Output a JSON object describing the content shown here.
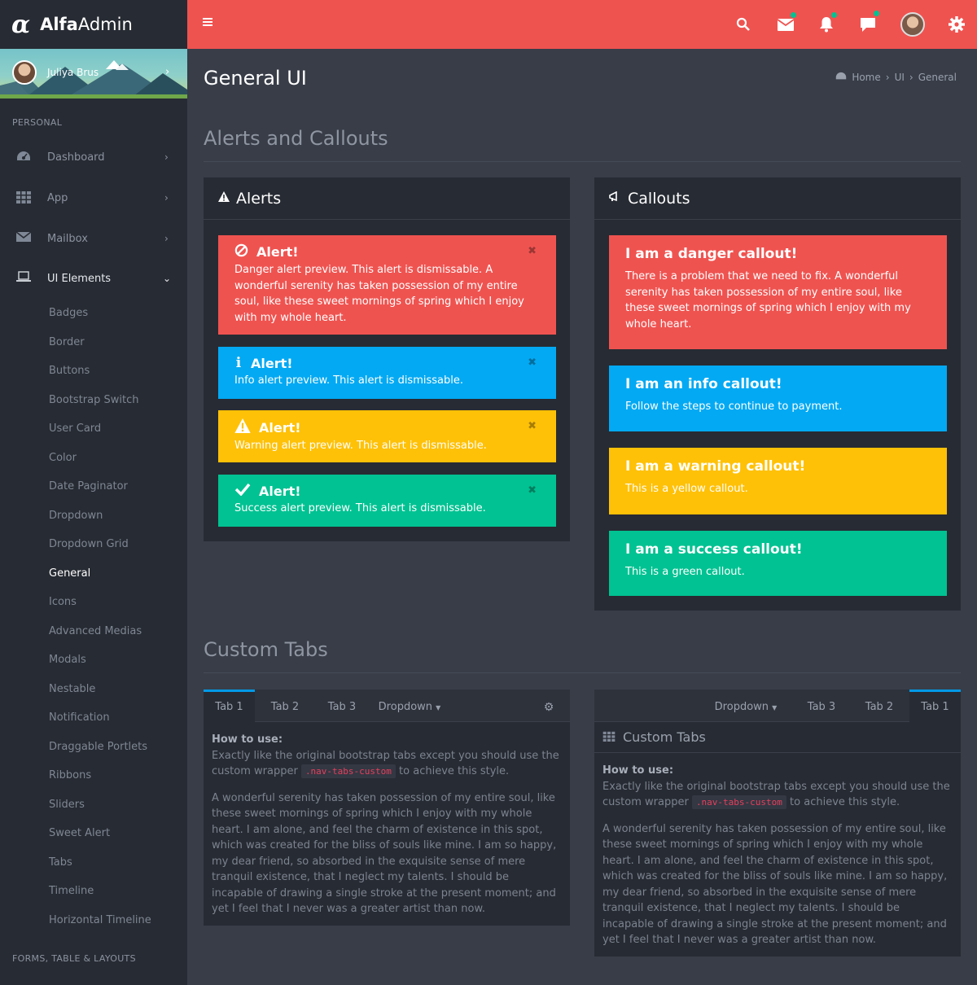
{
  "brand": {
    "symbol": "α",
    "bold": "Alfa",
    "normal": "Admin"
  },
  "user": {
    "name": "Juliya Brus"
  },
  "sidebar": {
    "section1": "PERSONAL",
    "items": [
      {
        "label": "Dashboard",
        "icon": "dashboard-icon"
      },
      {
        "label": "App",
        "icon": "apps-grid-icon"
      },
      {
        "label": "Mailbox",
        "icon": "mail-icon"
      },
      {
        "label": "UI Elements",
        "icon": "laptop-icon"
      }
    ],
    "subitems": [
      "Badges",
      "Border",
      "Buttons",
      "Bootstrap Switch",
      "User Card",
      "Color",
      "Date Paginator",
      "Dropdown",
      "Dropdown Grid",
      "General",
      "Icons",
      "Advanced Medias",
      "Modals",
      "Nestable",
      "Notification",
      "Draggable Portlets",
      "Ribbons",
      "Sliders",
      "Sweet Alert",
      "Tabs",
      "Timeline",
      "Horizontal Timeline"
    ],
    "current": "General",
    "section2": "FORMS, TABLE & LAYOUTS"
  },
  "topbar": {
    "icons": [
      "menu-icon",
      "search-icon",
      "mail-icon",
      "bell-icon",
      "chat-icon",
      "avatar",
      "gear-icon"
    ],
    "badge_color": "#00c292",
    "bg": "#ef5350"
  },
  "page": {
    "title": "General UI",
    "breadcrumb": [
      "Home",
      "UI",
      "General"
    ],
    "section1": "Alerts and Callouts",
    "section2": "Custom Tabs"
  },
  "alerts": {
    "title": "Alerts",
    "items": [
      {
        "title": "Alert!",
        "text": "Danger alert preview. This alert is dismissable. A wonderful serenity has taken possession of my entire soul, like these sweet mornings of spring which I enjoy with my whole heart.",
        "color": "#ef5350"
      },
      {
        "title": "Alert!",
        "text": "Info alert preview. This alert is dismissable.",
        "color": "#03a9f3"
      },
      {
        "title": "Alert!",
        "text": "Warning alert preview. This alert is dismissable.",
        "color": "#ffc107"
      },
      {
        "title": "Alert!",
        "text": "Success alert preview. This alert is dismissable.",
        "color": "#00c292"
      }
    ],
    "close": "✖"
  },
  "callouts": {
    "title": "Callouts",
    "items": [
      {
        "title": "I am a danger callout!",
        "text": "There is a problem that we need to fix. A wonderful serenity has taken possession of my entire soul, like these sweet mornings of spring which I enjoy with my whole heart."
      },
      {
        "title": "I am an info callout!",
        "text": "Follow the steps to continue to payment."
      },
      {
        "title": "I am a warning callout!",
        "text": "This is a yellow callout."
      },
      {
        "title": "I am a success callout!",
        "text": "This is a green callout."
      }
    ]
  },
  "tabs_left": {
    "tabs": [
      "Tab 1",
      "Tab 2",
      "Tab 3",
      "Dropdown"
    ],
    "how_to": "How to use:",
    "desc_before": "Exactly like the original bootstrap tabs except you should use the custom wrapper",
    "code": ".nav-tabs-custom",
    "desc_after": "to achieve this style.",
    "paragraph": "A wonderful serenity has taken possession of my entire soul, like these sweet mornings of spring which I enjoy with my whole heart. I am alone, and feel the charm of existence in this spot, which was created for the bliss of souls like mine. I am so happy, my dear friend, so absorbed in the exquisite sense of mere tranquil existence, that I neglect my talents. I should be incapable of drawing a single stroke at the present moment; and yet I feel that I never was a greater artist than now."
  },
  "tabs_right": {
    "tabs": [
      "Dropdown",
      "Tab 3",
      "Tab 2",
      "Tab 1"
    ],
    "header": "Custom Tabs"
  }
}
